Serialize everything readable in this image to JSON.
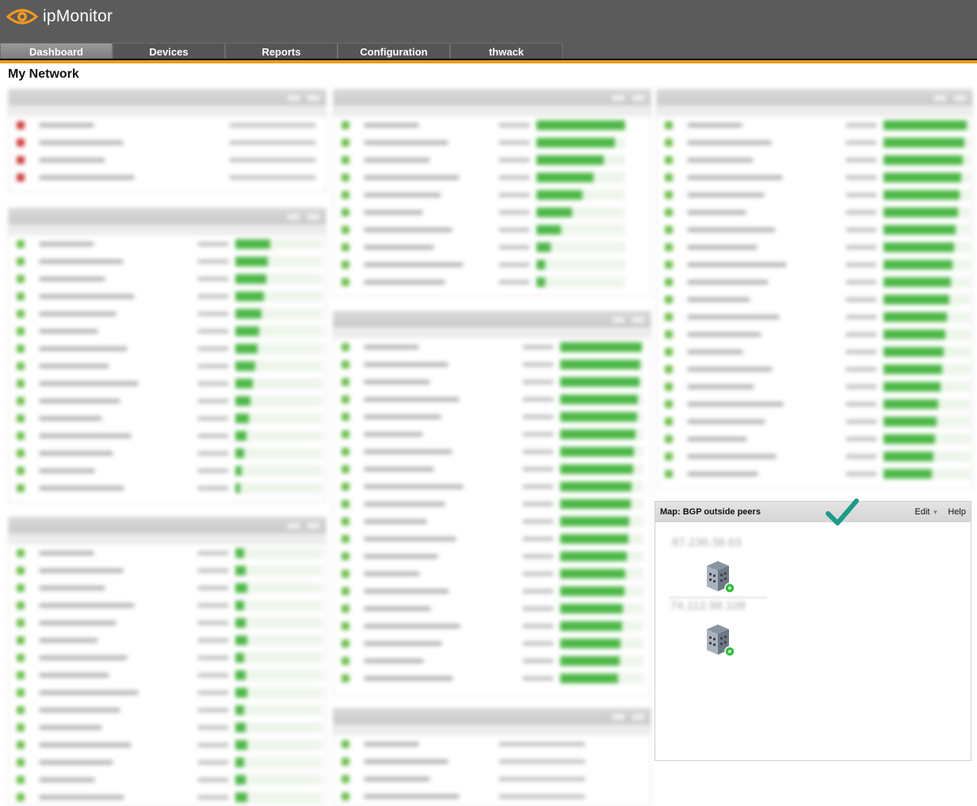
{
  "app": {
    "name": "ipMonitor"
  },
  "nav": {
    "tabs": [
      "Dashboard",
      "Devices",
      "Reports",
      "Configuration",
      "thwack"
    ],
    "active": "Dashboard"
  },
  "page": {
    "title": "My Network"
  },
  "map_widget": {
    "title": "Map: BGP outside peers",
    "edit_label": "Edit",
    "help_label": "Help",
    "node_labels": [
      "87.236.38.63",
      "74.112.98.108"
    ]
  },
  "colors": {
    "accent": "#f39a1e",
    "status_ok": "#4cb846",
    "status_down": "#d23b3b",
    "checkmark": "#1a9c8a"
  }
}
